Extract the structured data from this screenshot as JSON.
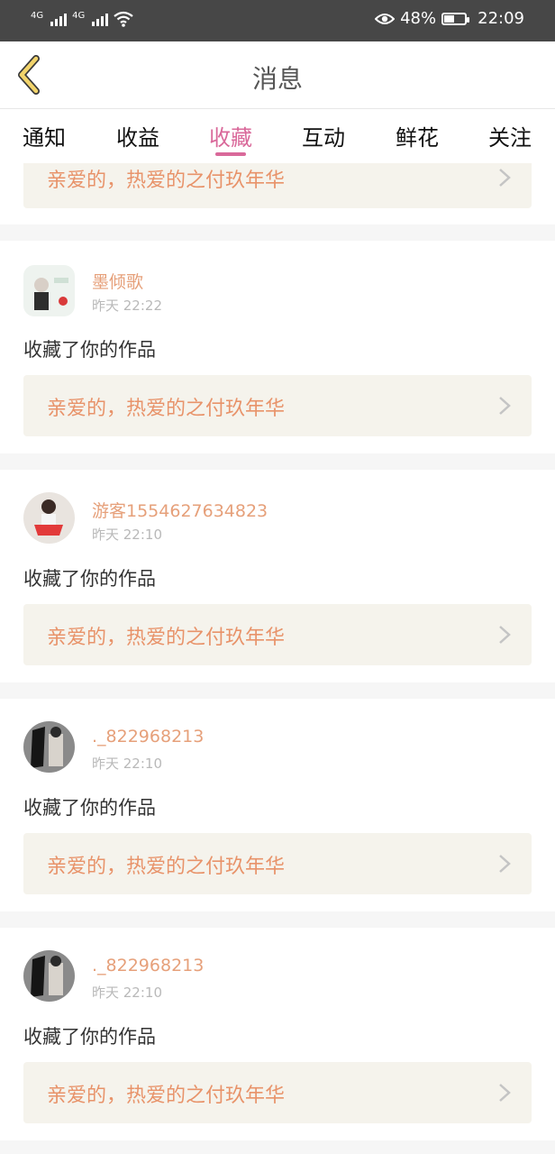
{
  "status_bar": {
    "network_1": "4G",
    "network_2": "4G",
    "battery_percent": "48%",
    "battery_level": 0.48,
    "time": "22:09"
  },
  "header": {
    "title": "消息"
  },
  "tabs": [
    {
      "label": "通知"
    },
    {
      "label": "收益"
    },
    {
      "label": "收藏"
    },
    {
      "label": "互动"
    },
    {
      "label": "鲜花"
    },
    {
      "label": "关注"
    }
  ],
  "active_tab": "收藏",
  "feed": {
    "partial_card": {
      "work_title": "亲爱的，热爱的之付玖年华"
    },
    "items": [
      {
        "user": "墨倾歌",
        "time": "昨天 22:22",
        "action": "收藏了你的作品",
        "work_title": "亲爱的，热爱的之付玖年华"
      },
      {
        "user": "游客1554627634823",
        "time": "昨天 22:10",
        "action": "收藏了你的作品",
        "work_title": "亲爱的，热爱的之付玖年华"
      },
      {
        "user": "._822968213",
        "time": "昨天 22:10",
        "action": "收藏了你的作品",
        "work_title": "亲爱的，热爱的之付玖年华"
      },
      {
        "user": "._822968213",
        "time": "昨天 22:10",
        "action": "收藏了你的作品",
        "work_title": "亲爱的，热爱的之付玖年华"
      }
    ]
  },
  "colors": {
    "accent_pink": "#d9699a",
    "username_orange": "#e6a07a",
    "work_title_orange": "#e8936a",
    "back_arrow_gold": "#f2d46b"
  }
}
